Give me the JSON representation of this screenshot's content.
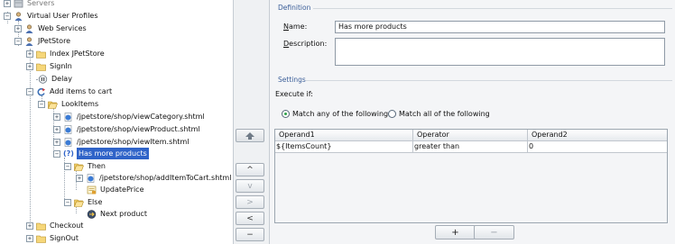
{
  "tree": {
    "servers": "Servers",
    "virtual_user_profiles": "Virtual User Profiles",
    "web_services": "Web Services",
    "jpetstore": "JPetStore",
    "index_jpetstore": "Index JPetStore",
    "signin": "SignIn",
    "delay": "Delay",
    "add_items_to_cart": "Add items to cart",
    "lookitems": "LookItems",
    "view_category": "/jpetstore/shop/viewCategory.shtml",
    "view_product": "/jpetstore/shop/viewProduct.shtml",
    "view_item": "/jpetstore/shop/viewItem.shtml",
    "has_more_products": "Has more products",
    "condition_mark": "(?)",
    "then": "Then",
    "add_item_to_cart": "/jpetstore/shop/addItemToCart.shtml",
    "update_price": "UpdatePrice",
    "else": "Else",
    "next_product": "Next product",
    "checkout": "Checkout",
    "signout": "SignOut"
  },
  "middle_buttons": {
    "up": "▲",
    "up_chevron": "^",
    "down_chevron": "v",
    "right_chevron": ">",
    "left_chevron": "<",
    "minus": "−"
  },
  "definition": {
    "group_title": "Definition",
    "name_label": "Name:",
    "name_value": "Has more products",
    "description_label": "Description:",
    "description_value": ""
  },
  "settings": {
    "group_title": "Settings",
    "execute_if": "Execute if:",
    "match_any": "Match any of the following",
    "match_all": "Match all of the following",
    "selected": "match_any"
  },
  "grid": {
    "headers": [
      "Operand1",
      "Operator",
      "Operand2"
    ],
    "rows": [
      [
        "${ItemsCount}",
        "greater than",
        "0"
      ]
    ]
  },
  "grid_buttons": {
    "add": "+",
    "remove": "−"
  },
  "colors": {
    "selection": "#2f63c8",
    "group_title": "#3c5f99",
    "radio_on": "#2fa34a"
  }
}
